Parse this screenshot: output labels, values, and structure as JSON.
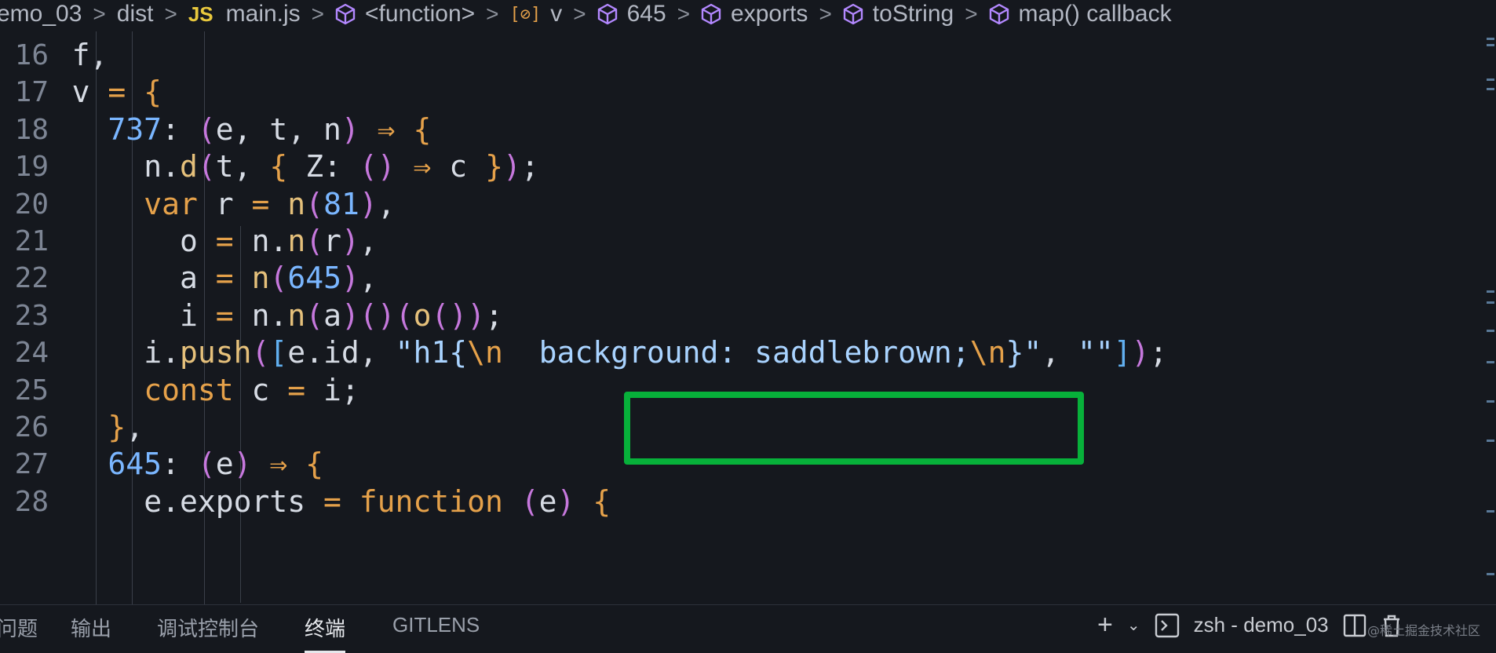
{
  "breadcrumb": {
    "items": [
      "emo_03",
      "dist",
      "main.js",
      "<function>",
      "v",
      "645",
      "exports",
      "toString",
      "map() callback"
    ]
  },
  "code_lines": [
    {
      "n": "16",
      "text": "f,"
    },
    {
      "n": "17",
      "text": "v = {"
    },
    {
      "n": "18",
      "text": "737: (e, t, n) ⇒ {"
    },
    {
      "n": "19",
      "text": "n.d(t, { Z: () ⇒ c });"
    },
    {
      "n": "20",
      "text": "var r = n(81),"
    },
    {
      "n": "21",
      "text": "o = n.n(r),"
    },
    {
      "n": "22",
      "text": "a = n(645),"
    },
    {
      "n": "23",
      "text": "i = n.n(a)()(o());"
    },
    {
      "n": "24",
      "text": "i.push([e.id, \"h1{\\n  background: saddlebrown;\\n}\", \"\"]);"
    },
    {
      "n": "25",
      "text": "const c = i;"
    },
    {
      "n": "26",
      "text": "},"
    },
    {
      "n": "27",
      "text": "645: (e) ⇒ {"
    },
    {
      "n": "28",
      "text": "e.exports = function (e) {"
    }
  ],
  "highlight": "background: saddlebrown;",
  "panel": {
    "tabs": [
      "问题",
      "输出",
      "调试控制台",
      "终端",
      "GITLENS"
    ],
    "active_tab": "终端",
    "terminal_name": "zsh - demo_03"
  },
  "watermark": "@稀土掘金技术社区",
  "colors": {
    "highlight_border": "#07b03a",
    "background": "#15181e"
  }
}
